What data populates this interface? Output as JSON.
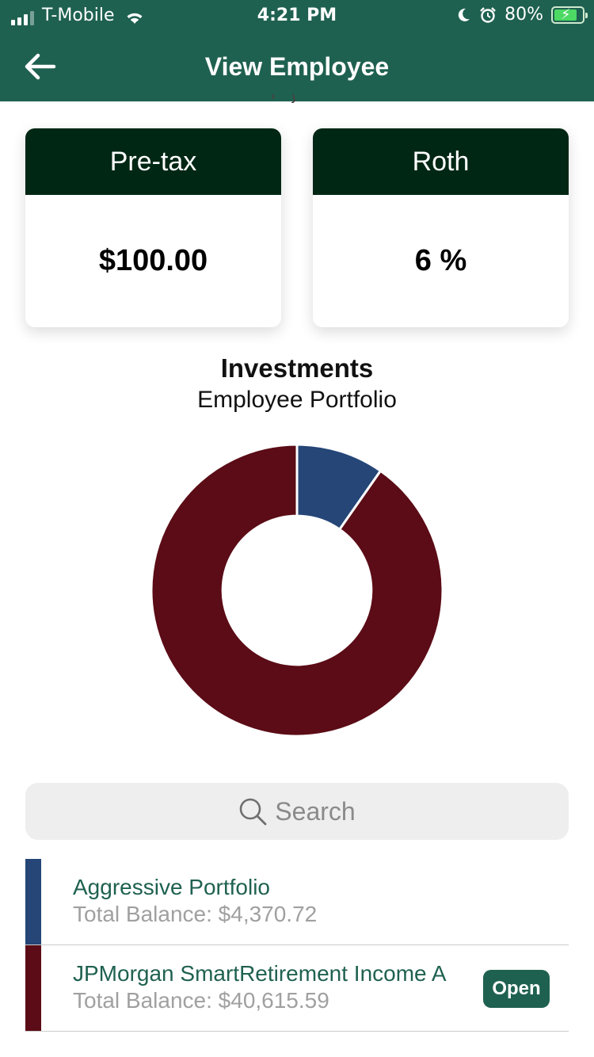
{
  "status_bar": {
    "carrier": "T-Mobile",
    "time": "4:21 PM",
    "battery": "80%"
  },
  "nav": {
    "title": "View Employee"
  },
  "cards": {
    "pretax": {
      "label": "Pre-tax",
      "value": "$100.00"
    },
    "roth": {
      "label": "Roth",
      "value": "6 %"
    }
  },
  "investments": {
    "title": "Investments",
    "subtitle": "Employee Portfolio"
  },
  "chart_data": {
    "type": "pie",
    "hole": 0.51,
    "slices": [
      {
        "label": "Aggressive Portfolio",
        "value": 4370.72,
        "color": "#254677"
      },
      {
        "label": "JPMorgan SmartRetirement Income A",
        "value": 40615.59,
        "color": "#5b0c16"
      }
    ]
  },
  "search": {
    "placeholder": "Search"
  },
  "portfolios": [
    {
      "name": "Aggressive Portfolio",
      "balance": "Total Balance: $4,370.72",
      "color": "#254677"
    },
    {
      "name": "JPMorgan SmartRetirement Income A",
      "balance": "Total Balance: $40,615.59",
      "color": "#5b0c16",
      "action": "Open"
    }
  ]
}
